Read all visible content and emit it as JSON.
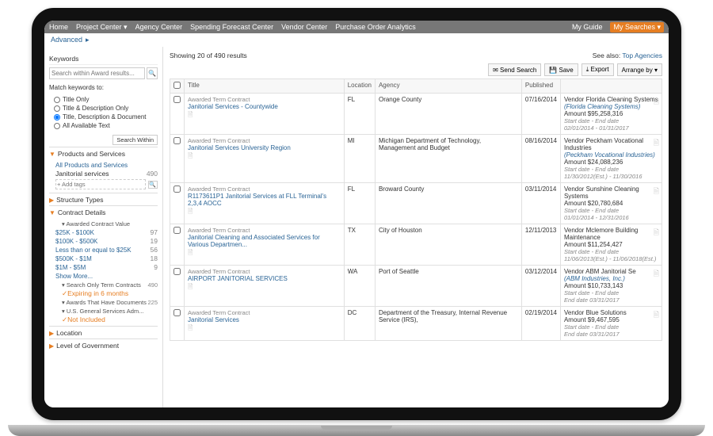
{
  "nav": {
    "items": [
      "Home",
      "Project Center ▾",
      "Agency Center",
      "Spending Forecast Center",
      "Vendor Center",
      "Purchase Order Analytics"
    ],
    "right1": "My Guide",
    "right2": "My Searches ▾"
  },
  "subnav": {
    "advanced": "Advanced",
    "arrow": "▸"
  },
  "sidebar": {
    "keywords": {
      "title": "Keywords",
      "placeholder": "Search within Award results...",
      "match_label": "Match keywords to:",
      "opts": [
        "Title Only",
        "Title & Description Only",
        "Title, Description & Document",
        "All Available Text"
      ],
      "search_within": "Search Within"
    },
    "products": {
      "title": "Products and Services",
      "all": "All Products and Services",
      "tag": "Janitorial services",
      "tag_count": "490",
      "add_tags": "+ Add tags"
    },
    "structure": {
      "title": "Structure Types"
    },
    "contract": {
      "title": "Contract Details",
      "sub_value": "Awarded Contract Value",
      "ranges": [
        {
          "label": "$25K - $100K",
          "count": "97"
        },
        {
          "label": "$100K - $500K",
          "count": "19"
        },
        {
          "label": "Less than or equal to $25K",
          "count": "56"
        },
        {
          "label": "$500K - $1M",
          "count": "18"
        },
        {
          "label": "$1M - $5M",
          "count": "9"
        }
      ],
      "show_more": "Show More...",
      "sub_search": "Search Only Term Contracts",
      "expiring": "Expiring in 6 months",
      "expiring_count": "490",
      "sub_awards": "Awards That Have Documents",
      "awards_count": "225",
      "sub_gsa": "U.S. General Services Adm...",
      "not_included": "Not Included"
    },
    "location": {
      "title": "Location"
    },
    "level": {
      "title": "Level of Government"
    }
  },
  "main": {
    "showing": "Showing 20 of 490 results",
    "see_also": "See also:",
    "top_agencies": "Top Agencies",
    "toolbar": {
      "send": "✉ Send Search",
      "save": "💾 Save",
      "export": "⤓ Export",
      "arrange": "Arrange by ▾"
    },
    "cols": {
      "check": "",
      "title": "Title",
      "location": "Location",
      "agency": "Agency",
      "published": "Published",
      "vendor": ""
    },
    "rows": [
      {
        "subhead": "Awarded Term Contract",
        "title": "Janitorial Services - Countywide",
        "location": "FL",
        "agency": "Orange County",
        "published": "07/16/2014",
        "vendor": "Florida Cleaning Systems",
        "vendor_link": "(Florida Cleaning Systems)",
        "amount": "$95,258,316",
        "dates": "02/01/2014 - 01/31/2017"
      },
      {
        "subhead": "Awarded Term Contract",
        "title": "Janitorial Services University Region",
        "location": "MI",
        "agency": "Michigan Department of Technology, Management and Budget",
        "published": "08/16/2014",
        "vendor": "Peckham Vocational Industries",
        "vendor_link": "(Peckham Vocational Industries)",
        "amount": "$24,088,236",
        "dates": "11/30/2012(Est.) - 11/30/2016"
      },
      {
        "subhead": "Awarded Term Contract",
        "title": "R1173611P1 Janitorial Services at FLL Terminal's 2,3,4 AOCC",
        "location": "FL",
        "agency": "Broward County",
        "published": "03/11/2014",
        "vendor": "Sunshine Cleaning Systems",
        "vendor_link": "",
        "amount": "$20,780,684",
        "dates": "01/01/2014 - 12/31/2016"
      },
      {
        "subhead": "Awarded Term Contract",
        "title": "Janitorial Cleaning and Associated Services for Various Departmen...",
        "location": "TX",
        "agency": "City of Houston",
        "published": "12/11/2013",
        "vendor": "Mclemore Building Maintenance",
        "vendor_link": "",
        "amount": "$11,254,427",
        "dates": "11/06/2013(Est.) - 11/06/2018(Est.)"
      },
      {
        "subhead": "Awarded Term Contract",
        "title": "AIRPORT JANITORIAL SERVICES",
        "location": "WA",
        "agency": "Port of Seattle",
        "published": "03/12/2014",
        "vendor": "ABM Janitorial Se",
        "vendor_link": "(ABM Industries, Inc.)",
        "amount": "$10,733,143",
        "dates": "End date 03/31/2017"
      },
      {
        "subhead": "Awarded Term Contract",
        "title": "Janitorial Services",
        "location": "DC",
        "agency": "Department of the Treasury, Internal Revenue Service (IRS),",
        "published": "02/19/2014",
        "vendor": "Blue Solutions",
        "vendor_link": "",
        "amount": "$9,467,595",
        "dates": "End date 03/31/2017"
      }
    ],
    "labels": {
      "vendor": "Vendor",
      "amount": "Amount",
      "dates_label": "Start date - End date"
    }
  }
}
